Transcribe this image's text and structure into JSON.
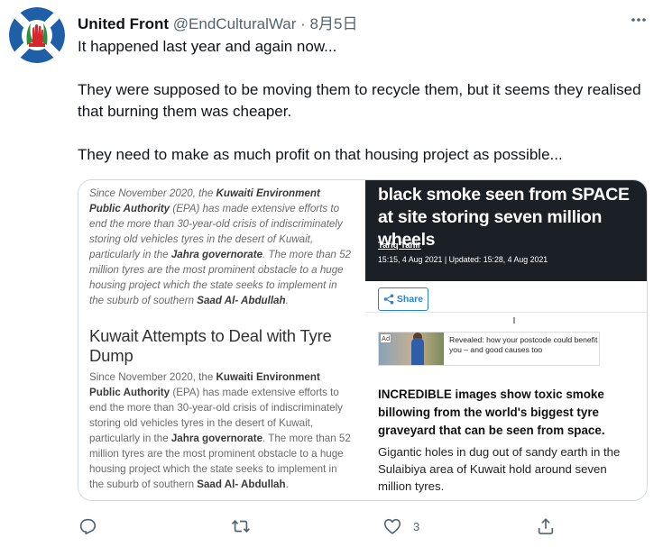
{
  "tweet": {
    "name": "United Front",
    "handle": "@EndCulturalWar",
    "separator": "·",
    "date": "8月5日",
    "text_lines": [
      "It happened last year and again now...",
      "",
      "They were supposed to be moving them  to recycle them, but it seems they realised that burning them was cheaper.",
      "",
      "They need to make as much profit on that housing project as possible..."
    ]
  },
  "media": {
    "left": {
      "para1": {
        "t1": "Since November 2020, the ",
        "b1": "Kuwaiti Environment Public Authority",
        "t2": " (EPA) has made extensive efforts to end the more than 30-year-old crisis of indiscriminately storing old vehicles tyres in the desert of Kuwait, particularly in the ",
        "b2": "Jahra governorate",
        "t3": ". The more than 52 million tyres are the most prominent obstacle to a huge housing project which the state seeks to implement in the suburb of southern ",
        "b3": "Saad Al- Abdullah",
        "t4": "."
      },
      "subheading": "Kuwait Attempts to Deal with Tyre Dump",
      "para2": {
        "t1": "Since November 2020, the ",
        "b1": "Kuwaiti Environment Public Authority",
        "t2": " (EPA) has made extensive efforts to end the more than 30-year-old crisis of indiscriminately storing old vehicles tyres in the desert of Kuwait, particularly in the ",
        "b2": "Jahra governorate",
        "t3": ". The more than 52 million tyres are the most prominent obstacle to a huge housing project which the state seeks to implement in the suburb of southern ",
        "b3": "Saad Al- Abdullah",
        "t4": "."
      }
    },
    "right": {
      "headline": "black smoke seen from SPACE at site storing seven million wheels",
      "author": "Tariq Tahir",
      "timestamp": "15:15, 4 Aug 2021 | Updated: 15:28, 4 Aug 2021",
      "share_label": "Share",
      "ad_label": "Ad",
      "ad_text": "Revealed: how your postcode could benefit you – and good causes too",
      "lead": "INCREDIBLE images show toxic smoke billowing from the world's biggest tyre graveyard that can be seen from space.",
      "desc": "Gigantic holes in dug out of sandy earth in the Sulaibiya area of Kuwait hold around seven million tyres."
    }
  },
  "actions": {
    "reply_icon": "reply-icon",
    "retweet_icon": "retweet-icon",
    "like_icon": "heart-icon",
    "like_count": "3",
    "share_icon": "share-icon"
  },
  "colors": {
    "secondary_text": "#536471",
    "border": "#cfd9de",
    "headline_bg": "#1b2026",
    "share_blue": "#2e82c9"
  }
}
